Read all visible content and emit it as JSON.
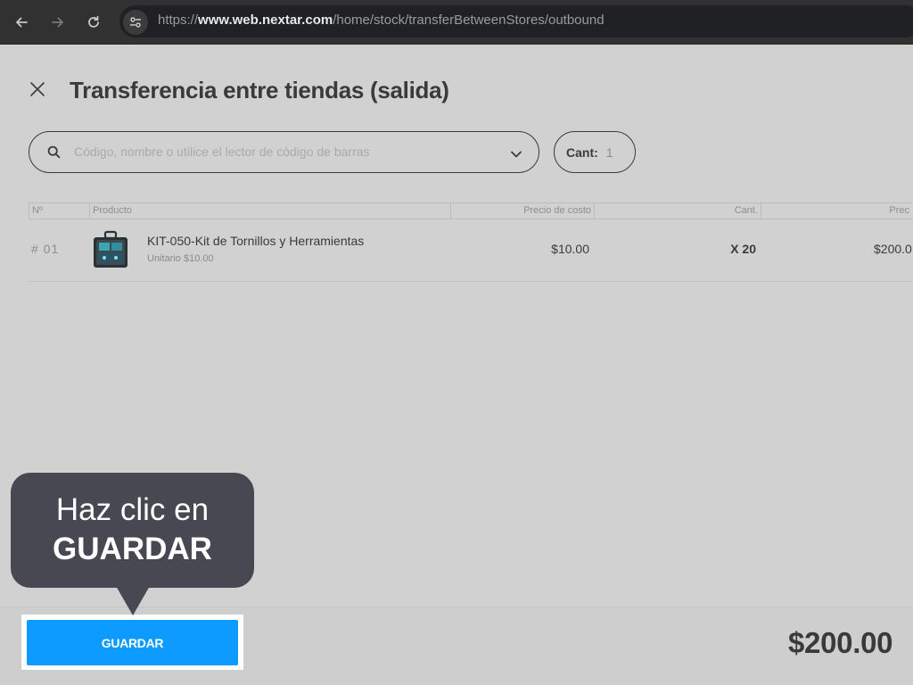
{
  "browser": {
    "url_prefix": "https://",
    "url_domain": "www.web.nextar.com",
    "url_path": "/home/stock/transferBetweenStores/outbound",
    "icons": [
      "back-arrow-icon",
      "forward-arrow-icon",
      "reload-icon",
      "site-settings-icon"
    ]
  },
  "header": {
    "title": "Transferencia entre tiendas (salida)"
  },
  "search": {
    "placeholder": "Código, nombre o utilice el lector de código de barras",
    "value": ""
  },
  "quantity": {
    "label": "Cant:",
    "value": "1"
  },
  "table": {
    "columns": [
      "Nº",
      "Producto",
      "Precio de costo",
      "Cant.",
      "Prec"
    ],
    "rows": [
      {
        "num": "# 01",
        "name": "KIT-050-Kit de Tornillos y Herramientas",
        "unit": "Unitario $10.00",
        "cost": "$10.00",
        "qty": "X 20",
        "total": "$200.0"
      }
    ]
  },
  "footer": {
    "save_label": "GUARDAR",
    "total": "$200.00"
  },
  "tooltip": {
    "line1": "Haz clic en",
    "line2": "GUARDAR"
  },
  "colors": {
    "page_bg": "#d2d1d2",
    "browser_bar": "#313131",
    "accent_button": "#0d9bff",
    "tooltip_bg": "#484852",
    "text_dark": "#3a3a3a"
  }
}
